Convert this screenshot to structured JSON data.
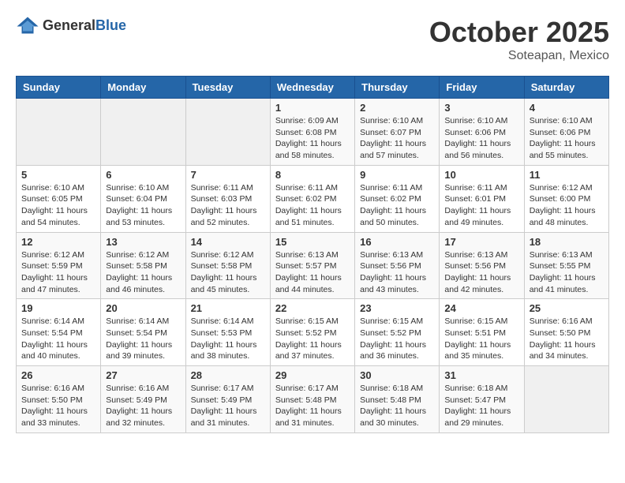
{
  "header": {
    "logo_general": "General",
    "logo_blue": "Blue",
    "month_year": "October 2025",
    "location": "Soteapan, Mexico"
  },
  "days_of_week": [
    "Sunday",
    "Monday",
    "Tuesday",
    "Wednesday",
    "Thursday",
    "Friday",
    "Saturday"
  ],
  "weeks": [
    [
      {
        "day": "",
        "info": ""
      },
      {
        "day": "",
        "info": ""
      },
      {
        "day": "",
        "info": ""
      },
      {
        "day": "1",
        "info": "Sunrise: 6:09 AM\nSunset: 6:08 PM\nDaylight: 11 hours\nand 58 minutes."
      },
      {
        "day": "2",
        "info": "Sunrise: 6:10 AM\nSunset: 6:07 PM\nDaylight: 11 hours\nand 57 minutes."
      },
      {
        "day": "3",
        "info": "Sunrise: 6:10 AM\nSunset: 6:06 PM\nDaylight: 11 hours\nand 56 minutes."
      },
      {
        "day": "4",
        "info": "Sunrise: 6:10 AM\nSunset: 6:06 PM\nDaylight: 11 hours\nand 55 minutes."
      }
    ],
    [
      {
        "day": "5",
        "info": "Sunrise: 6:10 AM\nSunset: 6:05 PM\nDaylight: 11 hours\nand 54 minutes."
      },
      {
        "day": "6",
        "info": "Sunrise: 6:10 AM\nSunset: 6:04 PM\nDaylight: 11 hours\nand 53 minutes."
      },
      {
        "day": "7",
        "info": "Sunrise: 6:11 AM\nSunset: 6:03 PM\nDaylight: 11 hours\nand 52 minutes."
      },
      {
        "day": "8",
        "info": "Sunrise: 6:11 AM\nSunset: 6:02 PM\nDaylight: 11 hours\nand 51 minutes."
      },
      {
        "day": "9",
        "info": "Sunrise: 6:11 AM\nSunset: 6:02 PM\nDaylight: 11 hours\nand 50 minutes."
      },
      {
        "day": "10",
        "info": "Sunrise: 6:11 AM\nSunset: 6:01 PM\nDaylight: 11 hours\nand 49 minutes."
      },
      {
        "day": "11",
        "info": "Sunrise: 6:12 AM\nSunset: 6:00 PM\nDaylight: 11 hours\nand 48 minutes."
      }
    ],
    [
      {
        "day": "12",
        "info": "Sunrise: 6:12 AM\nSunset: 5:59 PM\nDaylight: 11 hours\nand 47 minutes."
      },
      {
        "day": "13",
        "info": "Sunrise: 6:12 AM\nSunset: 5:58 PM\nDaylight: 11 hours\nand 46 minutes."
      },
      {
        "day": "14",
        "info": "Sunrise: 6:12 AM\nSunset: 5:58 PM\nDaylight: 11 hours\nand 45 minutes."
      },
      {
        "day": "15",
        "info": "Sunrise: 6:13 AM\nSunset: 5:57 PM\nDaylight: 11 hours\nand 44 minutes."
      },
      {
        "day": "16",
        "info": "Sunrise: 6:13 AM\nSunset: 5:56 PM\nDaylight: 11 hours\nand 43 minutes."
      },
      {
        "day": "17",
        "info": "Sunrise: 6:13 AM\nSunset: 5:56 PM\nDaylight: 11 hours\nand 42 minutes."
      },
      {
        "day": "18",
        "info": "Sunrise: 6:13 AM\nSunset: 5:55 PM\nDaylight: 11 hours\nand 41 minutes."
      }
    ],
    [
      {
        "day": "19",
        "info": "Sunrise: 6:14 AM\nSunset: 5:54 PM\nDaylight: 11 hours\nand 40 minutes."
      },
      {
        "day": "20",
        "info": "Sunrise: 6:14 AM\nSunset: 5:54 PM\nDaylight: 11 hours\nand 39 minutes."
      },
      {
        "day": "21",
        "info": "Sunrise: 6:14 AM\nSunset: 5:53 PM\nDaylight: 11 hours\nand 38 minutes."
      },
      {
        "day": "22",
        "info": "Sunrise: 6:15 AM\nSunset: 5:52 PM\nDaylight: 11 hours\nand 37 minutes."
      },
      {
        "day": "23",
        "info": "Sunrise: 6:15 AM\nSunset: 5:52 PM\nDaylight: 11 hours\nand 36 minutes."
      },
      {
        "day": "24",
        "info": "Sunrise: 6:15 AM\nSunset: 5:51 PM\nDaylight: 11 hours\nand 35 minutes."
      },
      {
        "day": "25",
        "info": "Sunrise: 6:16 AM\nSunset: 5:50 PM\nDaylight: 11 hours\nand 34 minutes."
      }
    ],
    [
      {
        "day": "26",
        "info": "Sunrise: 6:16 AM\nSunset: 5:50 PM\nDaylight: 11 hours\nand 33 minutes."
      },
      {
        "day": "27",
        "info": "Sunrise: 6:16 AM\nSunset: 5:49 PM\nDaylight: 11 hours\nand 32 minutes."
      },
      {
        "day": "28",
        "info": "Sunrise: 6:17 AM\nSunset: 5:49 PM\nDaylight: 11 hours\nand 31 minutes."
      },
      {
        "day": "29",
        "info": "Sunrise: 6:17 AM\nSunset: 5:48 PM\nDaylight: 11 hours\nand 31 minutes."
      },
      {
        "day": "30",
        "info": "Sunrise: 6:18 AM\nSunset: 5:48 PM\nDaylight: 11 hours\nand 30 minutes."
      },
      {
        "day": "31",
        "info": "Sunrise: 6:18 AM\nSunset: 5:47 PM\nDaylight: 11 hours\nand 29 minutes."
      },
      {
        "day": "",
        "info": ""
      }
    ]
  ]
}
